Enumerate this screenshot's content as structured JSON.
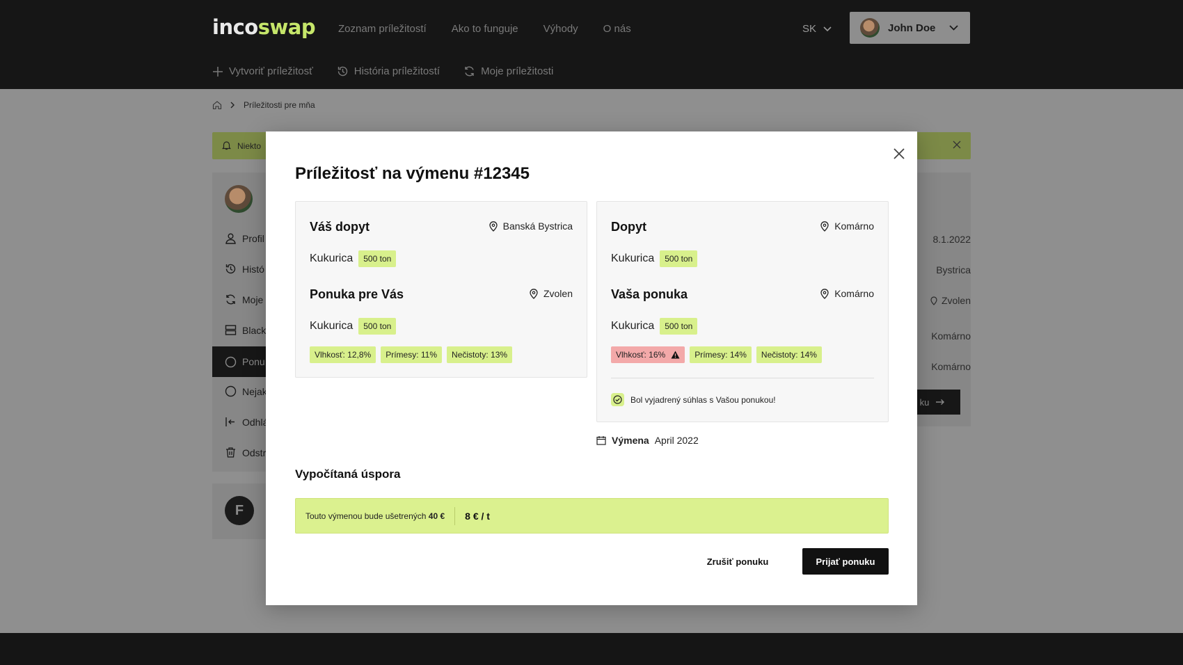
{
  "brand": {
    "part1": "inco",
    "part2": "swap"
  },
  "nav": [
    "Zoznam príležitostí",
    "Ako to funguje",
    "Výhody",
    "O nás"
  ],
  "lang": "SK",
  "user": {
    "name": "John Doe"
  },
  "subnav": [
    "Vytvoriť príležitosť",
    "História príležitostí",
    "Moje príležitosti"
  ],
  "breadcrumb": {
    "current": "Príležitosti pre mňa"
  },
  "alert": {
    "text": "Niekto"
  },
  "sidebar": [
    "Profil",
    "Histó",
    "Moje",
    "Black",
    "Ponu",
    "Nejak",
    "Odhlá",
    "Odstr"
  ],
  "sidebar2": {
    "initial": "F"
  },
  "right_col": {
    "date": "8.1.2022",
    "loc1": "Bystrica",
    "loc2": "Zvolen",
    "loc3": "Komárno",
    "loc4": "Komárno",
    "btn": "ku"
  },
  "modal": {
    "title": "Príležitosť na výmenu #12345",
    "left": {
      "h1": "Váš dopyt",
      "loc1": "Banská Bystrica",
      "p1": "Kukurica",
      "q1": "500 ton",
      "h2": "Ponuka pre Vás",
      "loc2": "Zvolen",
      "p2": "Kukurica",
      "q2": "500 ton",
      "tags": [
        "Vlhkosť: 12,8%",
        "Prímesy: 11%",
        "Nečistoty: 13%"
      ]
    },
    "right": {
      "h1": "Dopyt",
      "loc1": "Komárno",
      "p1": "Kukurica",
      "q1": "500 ton",
      "h2": "Vaša ponuka",
      "loc2": "Komárno",
      "p2": "Kukurica",
      "q2": "500 ton",
      "tags": [
        "Vlhkosť: 16%",
        "Prímesy: 14%",
        "Nečistoty: 14%"
      ],
      "consent": "Bol vyjadrený súhlas s Vašou ponukou!"
    },
    "vymena": {
      "label": "Výmena",
      "value": "April 2022"
    },
    "savings": {
      "title": "Vypočítaná úspora",
      "text": "Touto výmenou bude ušetrených",
      "amount": "40 €",
      "rate": "8 € / t"
    },
    "cancel": "Zrušiť ponuku",
    "accept": "Prijať ponuku"
  },
  "colors": {
    "accent": "#d8f08c",
    "warning": "#f3a9a9",
    "dark": "#161616"
  }
}
